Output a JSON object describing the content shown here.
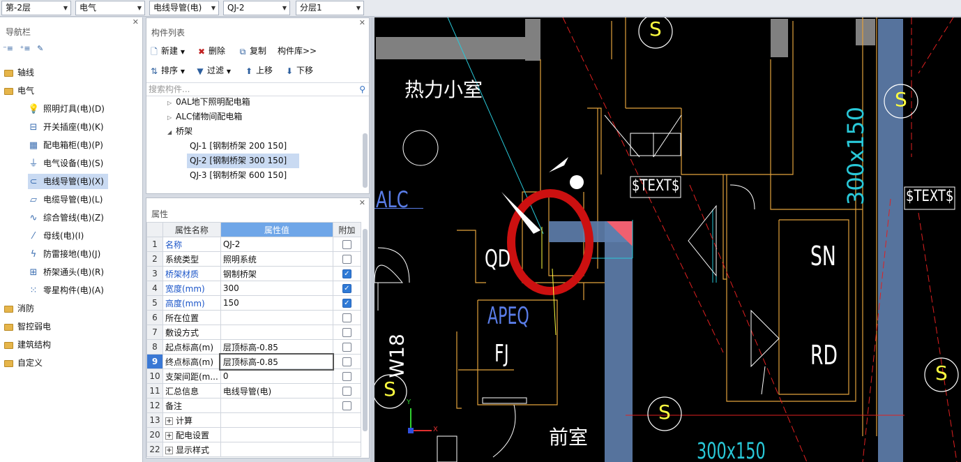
{
  "toolbar": {
    "floor": "第-2层",
    "discipline": "电气",
    "type": "电线导管(电)",
    "component": "QJ-2",
    "layer": "分层1"
  },
  "nav": {
    "title": "导航栏",
    "items": [
      {
        "label": "轴线",
        "kind": "folder"
      },
      {
        "label": "电气",
        "kind": "folder"
      },
      {
        "label": "照明灯具(电)(D)",
        "kind": "child",
        "icon": "bulb-icon"
      },
      {
        "label": "开关插座(电)(K)",
        "kind": "child",
        "icon": "socket-icon"
      },
      {
        "label": "配电箱柜(电)(P)",
        "kind": "child",
        "icon": "cabinet-icon"
      },
      {
        "label": "电气设备(电)(S)",
        "kind": "child",
        "icon": "device-icon"
      },
      {
        "label": "电线导管(电)(X)",
        "kind": "child",
        "icon": "conduit-icon"
      },
      {
        "label": "电缆导管(电)(L)",
        "kind": "child",
        "icon": "cable-icon"
      },
      {
        "label": "综合管线(电)(Z)",
        "kind": "child",
        "icon": "pipeline-icon"
      },
      {
        "label": "母线(电)(I)",
        "kind": "child",
        "icon": "busbar-icon"
      },
      {
        "label": "防雷接地(电)(J)",
        "kind": "child",
        "icon": "lightning-icon"
      },
      {
        "label": "桥架通头(电)(R)",
        "kind": "child",
        "icon": "tray-joint-icon"
      },
      {
        "label": "零星构件(电)(A)",
        "kind": "child",
        "icon": "grid-icon"
      },
      {
        "label": "消防",
        "kind": "folder"
      },
      {
        "label": "智控弱电",
        "kind": "folder"
      },
      {
        "label": "建筑结构",
        "kind": "folder"
      },
      {
        "label": "自定义",
        "kind": "folder"
      }
    ]
  },
  "complist": {
    "title": "构件列表",
    "new": "新建",
    "delete": "删除",
    "copy": "复制",
    "library": "构件库>>",
    "sort": "排序",
    "filter": "过滤",
    "up": "上移",
    "down": "下移",
    "search_placeholder": "搜索构件...",
    "tree": [
      "0AL地下照明配电箱",
      "ALC储物间配电箱",
      "桥架",
      "QJ-1 [钢制桥架 200 150]",
      "QJ-2 [钢制桥架 300 150]",
      "QJ-3 [钢制桥架 600 150]"
    ]
  },
  "props": {
    "title": "属性",
    "headers": [
      "属性名称",
      "属性值",
      "附加"
    ],
    "rows": [
      {
        "n": "1",
        "name": "名称",
        "value": "QJ-2"
      },
      {
        "n": "2",
        "name": "系统类型",
        "value": "照明系统"
      },
      {
        "n": "3",
        "name": "桥架材质",
        "value": "钢制桥架"
      },
      {
        "n": "4",
        "name": "宽度(mm)",
        "value": "300"
      },
      {
        "n": "5",
        "name": "高度(mm)",
        "value": "150"
      },
      {
        "n": "6",
        "name": "所在位置",
        "value": ""
      },
      {
        "n": "7",
        "name": "敷设方式",
        "value": ""
      },
      {
        "n": "8",
        "name": "起点标高(m)",
        "value": "层顶标高-0.85"
      },
      {
        "n": "9",
        "name": "终点标高(m)",
        "value": "层顶标高-0.85"
      },
      {
        "n": "10",
        "name": "支架间距(m...",
        "value": "0"
      },
      {
        "n": "11",
        "name": "汇总信息",
        "value": "电线导管(电)"
      },
      {
        "n": "12",
        "name": "备注",
        "value": ""
      },
      {
        "n": "13",
        "name": "计算",
        "value": ""
      },
      {
        "n": "20",
        "name": "配电设置",
        "value": ""
      },
      {
        "n": "22",
        "name": "显示样式",
        "value": ""
      }
    ],
    "checked": [
      false,
      false,
      true,
      true,
      true,
      false,
      false,
      false,
      false,
      false,
      false,
      false
    ]
  },
  "cad": {
    "texts": {
      "room1": "热力小室",
      "alc": "ALC",
      "qd": "QD",
      "apeq": "APEQ",
      "fj": "FJ",
      "w18": "W18",
      "sn": "SN",
      "rd": "RD",
      "front": "前室",
      "dim1": "300x150",
      "dim2": "300x150",
      "tag1": "$TEXT$",
      "tag2": "$TEXT$",
      "s": "S",
      "axis_x": "X",
      "axis_y": "Y"
    },
    "colors": {
      "tray": "#5f7fae",
      "wall": "#e3a23c",
      "red_circle": "#cc1010",
      "cyan": "#29c8d8"
    }
  }
}
